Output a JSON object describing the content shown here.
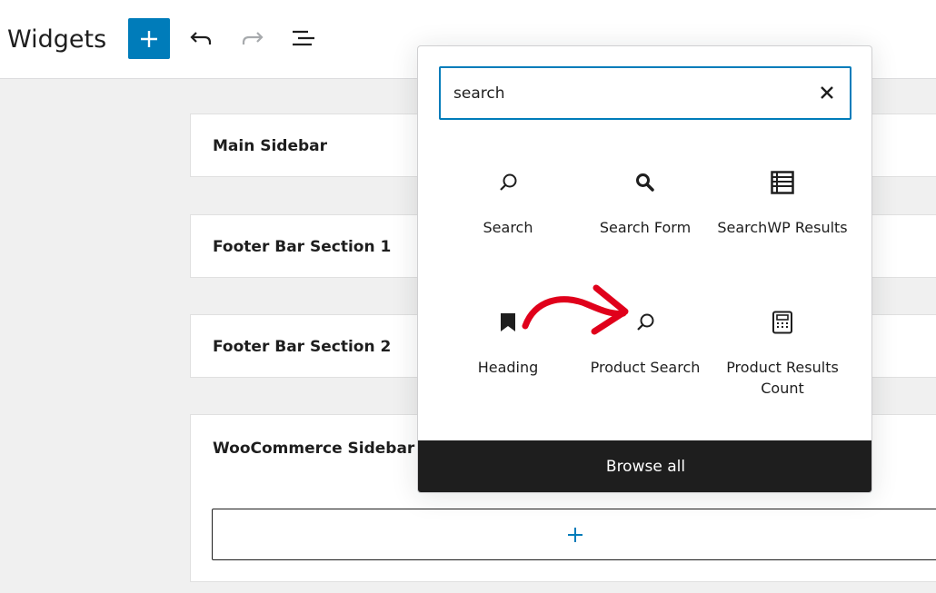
{
  "header": {
    "title": "Widgets",
    "add_block_label": "+",
    "undo_icon": "undo-icon",
    "redo_icon": "redo-icon",
    "list_view_icon": "list-view-icon"
  },
  "widget_areas": [
    {
      "title": "Main Sidebar"
    },
    {
      "title": "Footer Bar Section 1"
    },
    {
      "title": "Footer Bar Section 2"
    },
    {
      "title": "WooCommerce Sidebar"
    }
  ],
  "appender": {
    "label": "+"
  },
  "inserter": {
    "search": {
      "value": "search",
      "clear_icon": "close-icon"
    },
    "blocks": [
      {
        "label": "Search",
        "icon": "search-icon"
      },
      {
        "label": "Search Form",
        "icon": "search-form-icon"
      },
      {
        "label": "SearchWP Results",
        "icon": "list-icon"
      },
      {
        "label": "Heading",
        "icon": "bookmark-icon"
      },
      {
        "label": "Product Search",
        "icon": "search-icon"
      },
      {
        "label": "Product Results Count",
        "icon": "calculator-icon"
      }
    ],
    "browse_all_label": "Browse all"
  },
  "colors": {
    "accent": "#007cba",
    "annotation_arrow": "#e0001b",
    "dark_bar": "#1e1e1e",
    "canvas": "#f0f0f0"
  }
}
